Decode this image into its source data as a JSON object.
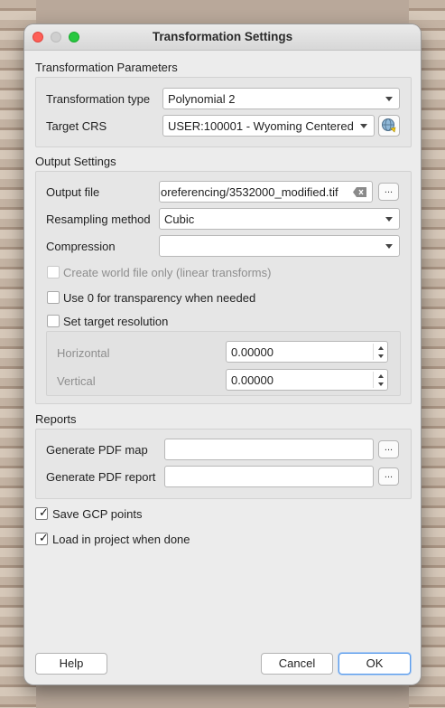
{
  "window": {
    "title": "Transformation Settings"
  },
  "transformation_parameters": {
    "title": "Transformation Parameters",
    "type_label": "Transformation type",
    "type_value": "Polynomial 2",
    "crs_label": "Target CRS",
    "crs_value": "USER:100001 - Wyoming Centered"
  },
  "output_settings": {
    "title": "Output Settings",
    "output_file_label": "Output file",
    "output_file_value": "oreferencing/3532000_modified.tif",
    "browse_label": "...",
    "resampling_label": "Resampling method",
    "resampling_value": "Cubic",
    "compression_label": "Compression",
    "compression_value": "",
    "world_file_label": "Create world file only (linear transforms)",
    "transparency_label": "Use 0 for transparency when needed",
    "target_resolution_label": "Set target resolution",
    "horizontal_label": "Horizontal",
    "horizontal_value": "0.00000",
    "vertical_label": "Vertical",
    "vertical_value": "0.00000"
  },
  "reports": {
    "title": "Reports",
    "pdf_map_label": "Generate PDF map",
    "pdf_map_value": "",
    "pdf_report_label": "Generate PDF report",
    "pdf_report_value": "",
    "browse_label": "..."
  },
  "options": {
    "save_gcp_label": "Save GCP points",
    "save_gcp_checked": true,
    "load_in_project_label": "Load in project when done",
    "load_in_project_checked": true
  },
  "buttons": {
    "help": "Help",
    "cancel": "Cancel",
    "ok": "OK"
  },
  "colors": {
    "accent": "#5a9bea",
    "close": "#fe5f57",
    "maximize": "#27c840"
  }
}
